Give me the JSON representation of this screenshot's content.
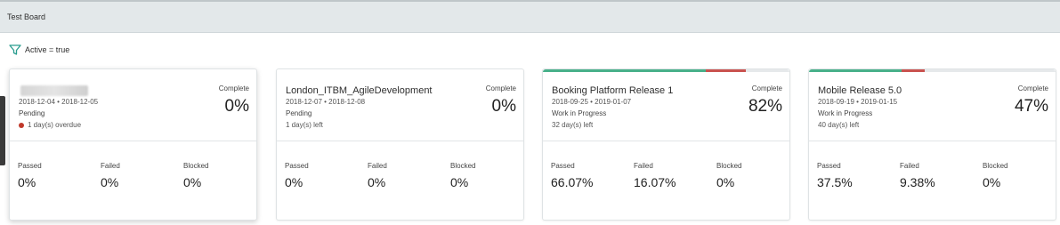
{
  "header": {
    "title": "Test Board"
  },
  "filter": {
    "text": "Active = true"
  },
  "cards": [
    {
      "name": "",
      "dates": "2018-12-04 • 2018-12-05",
      "state": "Pending",
      "days": "1 day(s) overdue",
      "complete_label": "Complete",
      "complete": "0%",
      "progress": {
        "passed_fraction": 0,
        "failed_fraction": 0
      },
      "stats": [
        {
          "label": "Passed",
          "value": "0%"
        },
        {
          "label": "Failed",
          "value": "0%"
        },
        {
          "label": "Blocked",
          "value": "0%"
        }
      ]
    },
    {
      "name": "London_ITBM_AgileDevelopment",
      "dates": "2018-12-07 • 2018-12-08",
      "state": "Pending",
      "days": "1 day(s) left",
      "complete_label": "Complete",
      "complete": "0%",
      "progress": {
        "passed_fraction": 0,
        "failed_fraction": 0
      },
      "stats": [
        {
          "label": "Passed",
          "value": "0%"
        },
        {
          "label": "Failed",
          "value": "0%"
        },
        {
          "label": "Blocked",
          "value": "0%"
        }
      ]
    },
    {
      "name": "Booking Platform Release 1",
      "dates": "2018-09-25 • 2019-01-07",
      "state": "Work in Progress",
      "days": "32 day(s) left",
      "complete_label": "Complete",
      "complete": "82%",
      "progress": {
        "passed_fraction": 0.6607,
        "failed_fraction": 0.1607
      },
      "stats": [
        {
          "label": "Passed",
          "value": "66.07%"
        },
        {
          "label": "Failed",
          "value": "16.07%"
        },
        {
          "label": "Blocked",
          "value": "0%"
        }
      ]
    },
    {
      "name": "Mobile Release 5.0",
      "dates": "2018-09-19 • 2019-01-15",
      "state": "Work in Progress",
      "days": "40 day(s) left",
      "complete_label": "Complete",
      "complete": "47%",
      "progress": {
        "passed_fraction": 0.375,
        "failed_fraction": 0.0938
      },
      "stats": [
        {
          "label": "Passed",
          "value": "37.5%"
        },
        {
          "label": "Failed",
          "value": "9.38%"
        },
        {
          "label": "Blocked",
          "value": "0%"
        }
      ]
    }
  ],
  "colors": {
    "passed": "#48b08a",
    "failed": "#c9524f",
    "overdue_dot": "#c0392b",
    "filter_icon": "#2a9d8f"
  },
  "icons": {
    "filter": "filter-funnel-icon",
    "overdue": "status-dot-icon"
  }
}
